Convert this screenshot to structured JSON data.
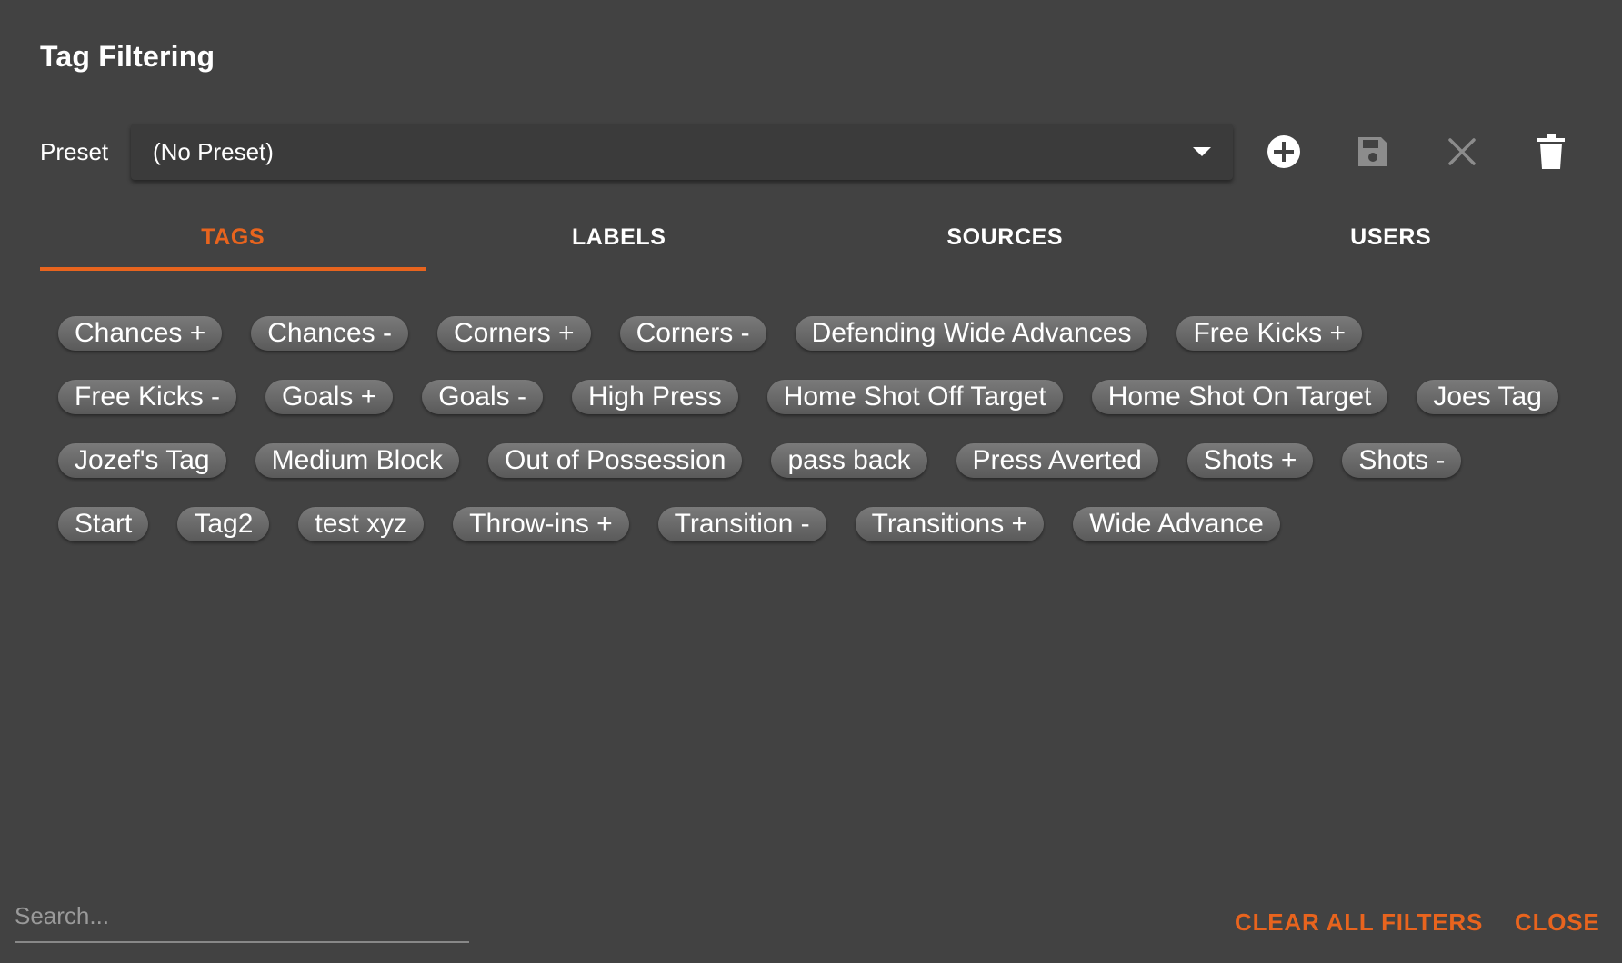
{
  "dialog": {
    "title": "Tag Filtering"
  },
  "preset": {
    "label": "Preset",
    "selected": "(No Preset)",
    "icons": {
      "add": "add-circle-icon",
      "save": "save-icon",
      "cancel": "close-icon",
      "delete": "trash-icon"
    }
  },
  "tabs": [
    {
      "label": "TAGS",
      "active": true
    },
    {
      "label": "LABELS",
      "active": false
    },
    {
      "label": "SOURCES",
      "active": false
    },
    {
      "label": "USERS",
      "active": false
    }
  ],
  "tags": [
    "Chances +",
    "Chances -",
    "Corners +",
    "Corners -",
    "Defending Wide Advances",
    "Free Kicks +",
    "Free Kicks -",
    "Goals +",
    "Goals -",
    "High Press",
    "Home Shot Off Target",
    "Home Shot On Target",
    "Joes Tag",
    "Jozef's Tag",
    "Medium Block",
    "Out of Possession",
    "pass back",
    "Press Averted",
    "Shots +",
    "Shots -",
    "Start",
    "Tag2",
    "test xyz",
    "Throw-ins +",
    "Transition -",
    "Transitions +",
    "Wide Advance"
  ],
  "search": {
    "placeholder": "Search...",
    "value": ""
  },
  "footer": {
    "clear_all": "CLEAR ALL FILTERS",
    "close": "CLOSE"
  },
  "colors": {
    "background": "#424242",
    "accent": "#e8641e",
    "chip": "#6a6a6a"
  }
}
